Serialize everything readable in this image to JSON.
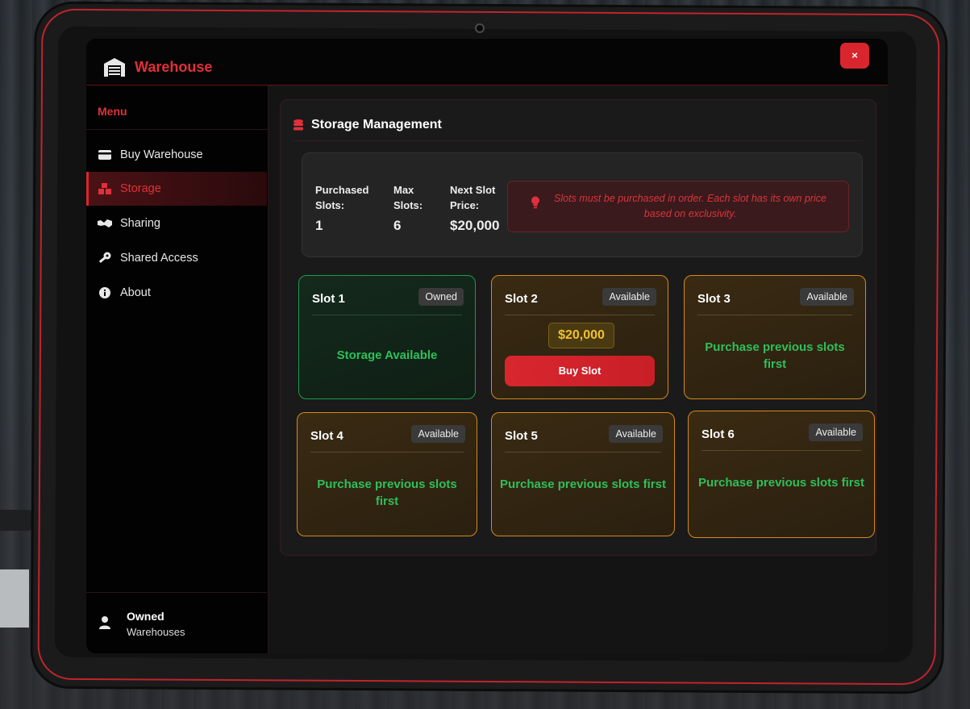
{
  "app": {
    "title": "Warehouse",
    "close_label": "×"
  },
  "sidebar": {
    "menu_title": "Menu",
    "items": [
      {
        "label": "Buy Warehouse",
        "icon": "credit-card-icon",
        "active": false
      },
      {
        "label": "Storage",
        "icon": "boxes-icon",
        "active": true
      },
      {
        "label": "Sharing",
        "icon": "handshake-icon",
        "active": false
      },
      {
        "label": "Shared Access",
        "icon": "key-icon",
        "active": false
      },
      {
        "label": "About",
        "icon": "info-icon",
        "active": false
      }
    ],
    "footer": {
      "title": "Owned",
      "subtitle": "Warehouses",
      "icon": "user-icon"
    }
  },
  "storage": {
    "title": "Storage Management",
    "stats": [
      {
        "label": "Purchased Slots:",
        "value": "1"
      },
      {
        "label": "Max Slots:",
        "value": "6"
      },
      {
        "label": "Next Slot Price:",
        "value": "$20,000"
      }
    ],
    "note": "Slots must be purchased in order. Each slot has its own price based on exclusivity.",
    "slots": [
      {
        "name": "Slot 1",
        "badge": "Owned",
        "message": "Storage Available",
        "status": "owned"
      },
      {
        "name": "Slot 2",
        "badge": "Available",
        "price": "$20,000",
        "button": "Buy Slot",
        "status": "purchasable"
      },
      {
        "name": "Slot 3",
        "badge": "Available",
        "message": "Purchase previous slots first",
        "status": "locked"
      },
      {
        "name": "Slot 4",
        "badge": "Available",
        "message": "Purchase previous slots first",
        "status": "locked"
      },
      {
        "name": "Slot 5",
        "badge": "Available",
        "message": "Purchase previous slots first",
        "status": "locked"
      },
      {
        "name": "Slot 6",
        "badge": "Available",
        "message": "Purchase previous slots first",
        "status": "locked"
      }
    ]
  },
  "colors": {
    "accent": "#e0303a",
    "owned_border": "#1e9a4a",
    "available_border": "#d38a17",
    "price": "#f2c12e",
    "success_text": "#2fbf5a"
  }
}
